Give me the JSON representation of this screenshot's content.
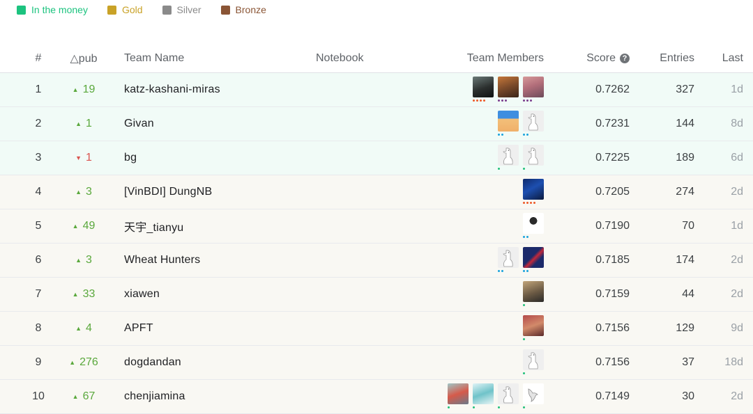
{
  "legend": [
    {
      "label": "In the money",
      "color": "#1cc37f"
    },
    {
      "label": "Gold",
      "color": "#c9a227"
    },
    {
      "label": "Silver",
      "color": "#8a8a8a"
    },
    {
      "label": "Bronze",
      "color": "#8a5535"
    }
  ],
  "columns": {
    "rank": "#",
    "delta": "△pub",
    "team": "Team Name",
    "notebook": "Notebook",
    "members": "Team Members",
    "score": "Score",
    "entries": "Entries",
    "last": "Last"
  },
  "rows": [
    {
      "rank": "1",
      "delta": "19",
      "dir": "up",
      "team": "katz-kashani-miras",
      "score": "0.7262",
      "entries": "327",
      "last": "1d",
      "zone": "money",
      "members": [
        {
          "avatar": "photo-dark",
          "tier": "grandmaster"
        },
        {
          "avatar": "photo-warm",
          "tier": "master"
        },
        {
          "avatar": "photo-group",
          "tier": "master"
        }
      ]
    },
    {
      "rank": "2",
      "delta": "1",
      "dir": "up",
      "team": "Givan",
      "score": "0.7231",
      "entries": "144",
      "last": "8d",
      "zone": "money",
      "members": [
        {
          "avatar": "cartoon-face",
          "tier": "expert"
        },
        {
          "avatar": "default-goose",
          "tier": "expert"
        }
      ]
    },
    {
      "rank": "3",
      "delta": "1",
      "dir": "down",
      "team": "bg",
      "score": "0.7225",
      "entries": "189",
      "last": "6d",
      "zone": "money",
      "members": [
        {
          "avatar": "default-goose",
          "tier": "contributor"
        },
        {
          "avatar": "default-goose",
          "tier": "contributor"
        }
      ]
    },
    {
      "rank": "4",
      "delta": "3",
      "dir": "up",
      "team": "[VinBDI] DungNB",
      "score": "0.7205",
      "entries": "274",
      "last": "2d",
      "zone": "rest",
      "members": [
        {
          "avatar": "photo-blue",
          "tier": "grandmaster"
        }
      ]
    },
    {
      "rank": "5",
      "delta": "49",
      "dir": "up",
      "team": "天宇_tianyu",
      "score": "0.7190",
      "entries": "70",
      "last": "1d",
      "zone": "rest",
      "members": [
        {
          "avatar": "photo-bw",
          "tier": "expert"
        }
      ]
    },
    {
      "rank": "6",
      "delta": "3",
      "dir": "up",
      "team": "Wheat Hunters",
      "score": "0.7185",
      "entries": "174",
      "last": "2d",
      "zone": "rest",
      "members": [
        {
          "avatar": "default-goose",
          "tier": "expert"
        },
        {
          "avatar": "photo-navy-red",
          "tier": "expert"
        }
      ]
    },
    {
      "rank": "7",
      "delta": "33",
      "dir": "up",
      "team": "xiawen",
      "score": "0.7159",
      "entries": "44",
      "last": "2d",
      "zone": "rest",
      "members": [
        {
          "avatar": "photo-person",
          "tier": "contributor"
        }
      ]
    },
    {
      "rank": "8",
      "delta": "4",
      "dir": "up",
      "team": "APFT",
      "score": "0.7156",
      "entries": "129",
      "last": "9d",
      "zone": "rest",
      "members": [
        {
          "avatar": "photo-red",
          "tier": "contributor"
        }
      ]
    },
    {
      "rank": "9",
      "delta": "276",
      "dir": "up",
      "team": "dogdandan",
      "score": "0.7156",
      "entries": "37",
      "last": "18d",
      "zone": "rest",
      "members": [
        {
          "avatar": "default-goose",
          "tier": "contributor"
        }
      ]
    },
    {
      "rank": "10",
      "delta": "67",
      "dir": "up",
      "team": "chenjiamina",
      "score": "0.7149",
      "entries": "30",
      "last": "2d",
      "zone": "rest",
      "members": [
        {
          "avatar": "cartoon-robot",
          "tier": "contributor"
        },
        {
          "avatar": "cartoon-teal",
          "tier": "contributor"
        },
        {
          "avatar": "default-goose",
          "tier": "contributor"
        },
        {
          "avatar": "white-bird",
          "tier": "contributor"
        }
      ]
    }
  ]
}
